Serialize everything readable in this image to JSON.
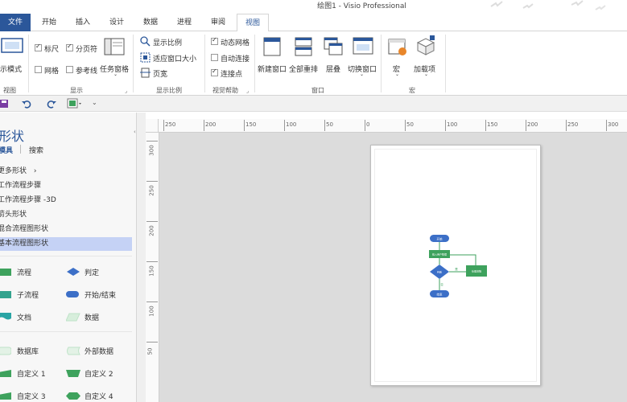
{
  "window": {
    "title": "绘图1 - Visio Professional"
  },
  "tabs": [
    {
      "label": "文件",
      "type": "file"
    },
    {
      "label": "开始"
    },
    {
      "label": "插入"
    },
    {
      "label": "设计"
    },
    {
      "label": "数据"
    },
    {
      "label": "进程"
    },
    {
      "label": "审阅"
    },
    {
      "label": "视图",
      "active": true
    }
  ],
  "ribbon": {
    "view_group": {
      "button": "示模式",
      "label": "视图"
    },
    "show_group": {
      "ruler": "标尺",
      "pagebreak": "分页符",
      "grid": "网格",
      "guides": "参考线",
      "task_panes": "任务窗格",
      "label": "显示",
      "ruler_checked": true,
      "pagebreak_checked": true,
      "grid_checked": false,
      "guides_checked": false
    },
    "zoom_group": {
      "zoom": "显示比例",
      "fit": "适应窗口大小",
      "page_width": "页宽",
      "label": "显示比例"
    },
    "visual_group": {
      "dynamic_grid": "动态网格",
      "autoconnect": "自动连接",
      "connection_points": "连接点",
      "label": "视觉帮助",
      "dynamic_grid_checked": true,
      "autoconnect_checked": false,
      "connection_points_checked": true
    },
    "window_group": {
      "new_window": "新建窗口",
      "arrange_all": "全部重排",
      "cascade": "层叠",
      "switch": "切换窗口",
      "label": "窗口"
    },
    "macro_group": {
      "macros": "宏",
      "addins": "加载项",
      "label": "宏"
    }
  },
  "shapes_pane": {
    "title": "形状",
    "tab_stencils": "模具",
    "tab_search": "搜索",
    "stencils": [
      {
        "label": "更多形状",
        "arrow": "›"
      },
      {
        "label": "工作流程步骤"
      },
      {
        "label": "工作流程步骤 -3D"
      },
      {
        "label": "箭头形状"
      },
      {
        "label": "混合流程图形状"
      },
      {
        "label": "基本流程图形状",
        "selected": true
      }
    ],
    "shapes": [
      {
        "label": "流程",
        "col": 0,
        "row": 0,
        "color": "#3ea25d"
      },
      {
        "label": "判定",
        "col": 1,
        "row": 0,
        "color": "#3c6fc7"
      },
      {
        "label": "子流程",
        "col": 0,
        "row": 1,
        "color": "#33a38e"
      },
      {
        "label": "开始/结束",
        "col": 1,
        "row": 1,
        "color": "#3c6fc7"
      },
      {
        "label": "文档",
        "col": 0,
        "row": 2,
        "color": "#2aa5a5"
      },
      {
        "label": "数据",
        "col": 1,
        "row": 2,
        "color": "#bfe3c8"
      },
      {
        "label": "数据库",
        "col": 0,
        "row": 3,
        "color": "#bfe3c8"
      },
      {
        "label": "外部数据",
        "col": 1,
        "row": 3,
        "color": "#bfe3c8"
      },
      {
        "label": "自定义 1",
        "col": 0,
        "row": 4,
        "color": "#3ea25d"
      },
      {
        "label": "自定义 2",
        "col": 1,
        "row": 4,
        "color": "#3ea25d"
      },
      {
        "label": "自定义 3",
        "col": 0,
        "row": 5,
        "color": "#3ea25d"
      },
      {
        "label": "自定义 4",
        "col": 1,
        "row": 5,
        "color": "#3ea25d"
      }
    ]
  },
  "hruler": {
    "labels": [
      "250",
      "200",
      "150",
      "100",
      "50",
      "0",
      "50",
      "100",
      "150",
      "200",
      "250",
      "300"
    ]
  },
  "vruler": {
    "labels": [
      "300",
      "250",
      "200",
      "150",
      "100",
      "50"
    ]
  },
  "diagram": {
    "start": "开始",
    "process": "输入用户数据",
    "decision": "判断",
    "yes": "是",
    "no": "否",
    "step": "处理流程",
    "end": "结束",
    "green": "#3ea25d",
    "blue": "#3c6fc7"
  }
}
